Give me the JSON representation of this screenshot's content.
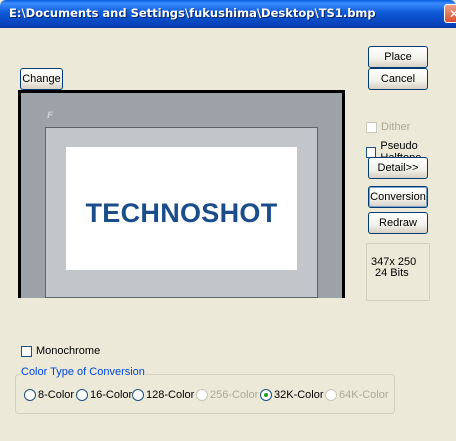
{
  "window": {
    "title": "E:\\Documents and Settings\\fukushima\\Desktop\\TS1.bmp",
    "close_glyph": "✕"
  },
  "buttons": {
    "change": "Change",
    "place": "Place",
    "cancel": "Cancel",
    "detail": "Detail>>",
    "conversion": "Conversion",
    "redraw": "Redraw"
  },
  "preview": {
    "panel_logo": "F",
    "brand_text": "TECHNOSHOT"
  },
  "options": {
    "dither": "Dither",
    "pseudo_halftone": "Pseudo Halftone",
    "monochrome": "Monochrome"
  },
  "image_info": {
    "size": "347x 250",
    "bits": "24 Bits"
  },
  "color_group": {
    "label": "Color Type of Conversion",
    "selected": "32K-Color",
    "options": [
      "8-Color",
      "16-Color",
      "128-Color",
      "256-Color",
      "32K-Color",
      "64K-Color"
    ]
  }
}
